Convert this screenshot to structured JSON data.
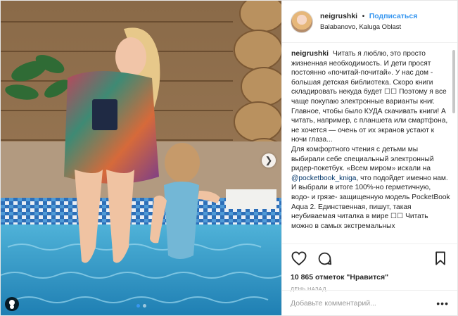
{
  "post": {
    "username": "neigrushki",
    "separator": "•",
    "follow_label": "Подписаться",
    "location": "Balabanovo, Kaluga Oblast",
    "caption_text": "Читать я люблю, это просто жизненная необходимость. И дети просят постоянно «почитай-почитай». У нас дом - большая детская библиотека. Скоро книги складировать некуда будет ☐☐ Поэтому я все чаще покупаю электронные варианты книг. Главное, чтобы было КУДА скачивать книги! А читать, например, с планшета или смартфона, не хочется — очень от их экранов устают к ночи глаза...",
    "caption_text_2_before": "Для комфортного чтения с детьми мы выбирали себе специальный электронный ридер-покетбук. «Всем миром» искали на ",
    "caption_mention": "@pocketbook_kniga",
    "caption_text_2_after": ", что подойдет именно нам. И выбрали в итоге 100%-но герметичную, водо- и грязе- защищенную модель PocketBook Aqua 2. Единственная, пишут, такая неубиваемая читалка в мире ☐☐ Читать можно в самых экстремальных",
    "likes": "10 865 отметок \"Нравится\"",
    "time": "День назад",
    "comment_placeholder": "Добавьте комментарий...",
    "more_label": "•••"
  },
  "media": {
    "next_icon": "chevron-right-icon",
    "slides_total": 2,
    "slide_active": 1
  },
  "icons": {
    "like": "heart-icon",
    "comment": "comment-icon",
    "bookmark": "bookmark-icon",
    "user_tag": "user-tag-icon"
  },
  "colors": {
    "accent": "#3897f0",
    "text": "#262626",
    "muted": "#999999",
    "border": "#efefef"
  }
}
